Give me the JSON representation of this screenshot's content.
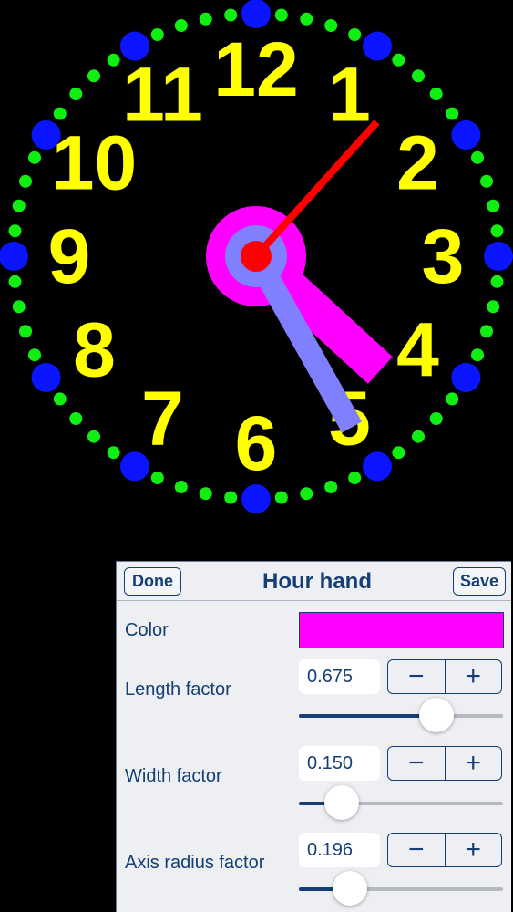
{
  "clock": {
    "numerals": [
      "12",
      "1",
      "2",
      "3",
      "4",
      "5",
      "6",
      "7",
      "8",
      "9",
      "10",
      "11"
    ],
    "time": {
      "hour": 4,
      "minute": 25,
      "second": 7
    },
    "colors": {
      "background": "#000000",
      "numerals": "#ffff00",
      "hour_dots": "#0a14ff",
      "minute_dots": "#11ee11",
      "hour_hand": "#ff00ff",
      "minute_hand": "#8080ff",
      "second_hand": "#ff0000"
    }
  },
  "panel": {
    "title": "Hour hand",
    "done_label": "Done",
    "save_label": "Save",
    "color_label": "Color",
    "color_value": "#ff00ff",
    "settings": [
      {
        "label": "Length factor",
        "value": "0.675",
        "slider_fraction": 0.675,
        "minus": "−",
        "plus": "+"
      },
      {
        "label": "Width factor",
        "value": "0.150",
        "slider_fraction": 0.21,
        "minus": "−",
        "plus": "+"
      },
      {
        "label": "Axis radius factor",
        "value": "0.196",
        "slider_fraction": 0.25,
        "minus": "−",
        "plus": "+"
      }
    ]
  }
}
